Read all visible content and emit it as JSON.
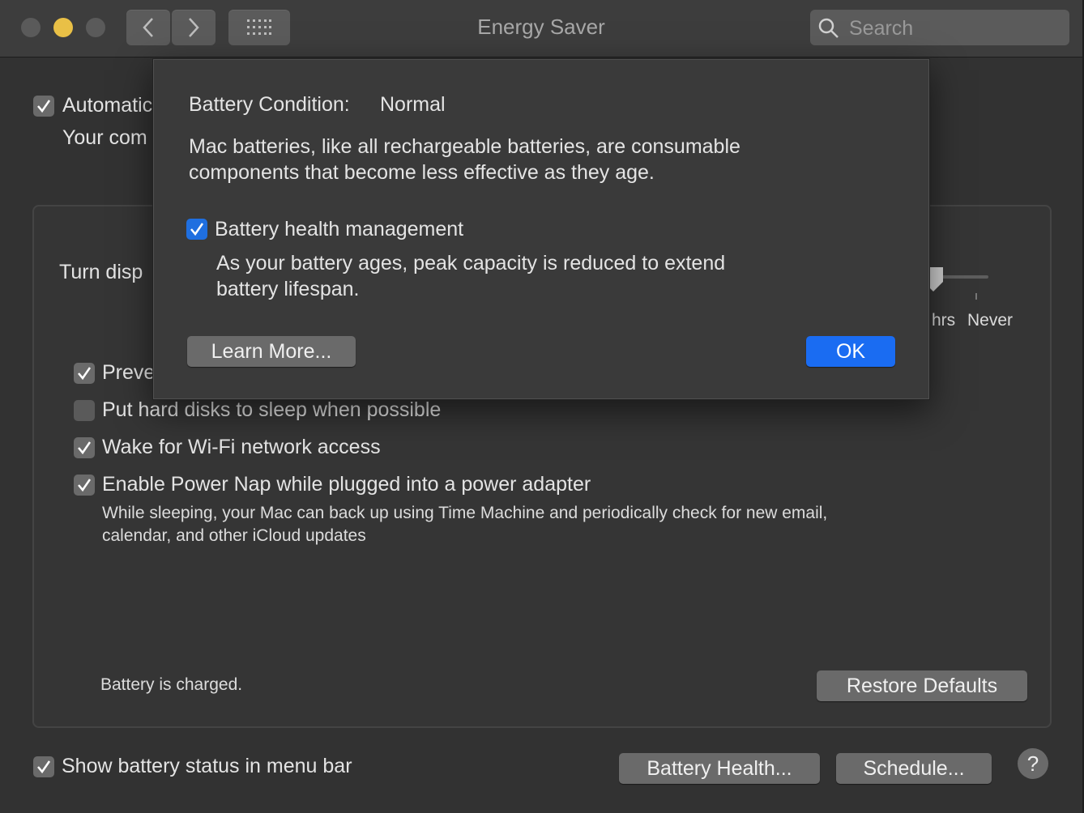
{
  "window": {
    "title": "Energy Saver"
  },
  "search": {
    "placeholder": "Search"
  },
  "background": {
    "auto_switch_label": "Automatic",
    "auto_switch_sub": "Your com",
    "turn_display_label": "Turn disp",
    "slider_labels": [
      "hrs",
      "Never"
    ],
    "options": [
      {
        "label": "Preve",
        "checked": true
      },
      {
        "label": "Put hard disks to sleep when possible",
        "checked": false
      },
      {
        "label": "Wake for Wi-Fi network access",
        "checked": true
      },
      {
        "label": "Enable Power Nap while plugged into a power adapter",
        "checked": true
      }
    ],
    "power_nap_desc_1": "While sleeping, your Mac can back up using Time Machine and periodically check for new email,",
    "power_nap_desc_2": "calendar, and other iCloud updates",
    "battery_status": "Battery is charged.",
    "restore_defaults": "Restore Defaults",
    "show_battery_status": "Show battery status in menu bar",
    "battery_health_button": "Battery Health...",
    "schedule_button": "Schedule...",
    "help": "?"
  },
  "sheet": {
    "condition_label": "Battery Condition:",
    "condition_value": "Normal",
    "desc_1": "Mac batteries, like all rechargeable batteries, are consumable",
    "desc_2": "components that become less effective as they age.",
    "health_management_label": "Battery health management",
    "health_management_checked": true,
    "health_desc_1": "As your battery ages, peak capacity is reduced to extend",
    "health_desc_2": "battery lifespan.",
    "learn_more": "Learn More...",
    "ok": "OK"
  },
  "colors": {
    "accent": "#1a6cf2",
    "minimize": "#e9c046",
    "window_bg": "#323232"
  }
}
